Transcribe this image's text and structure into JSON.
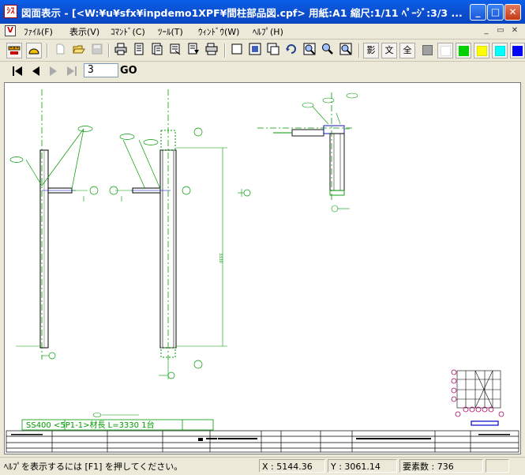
{
  "window": {
    "app_icon": "ｼｽ",
    "title": "図面表示 - [<W:¥u¥sfx¥inpdemo1XPF¥間柱部品図.cpf> 用紙:A1 縮尺:1/11 ﾍﾟｰｼﾞ:3/3 ...",
    "minimize_label": "_",
    "maximize_label": "□",
    "close_label": "✕"
  },
  "menubar": {
    "items": [
      "ﾌｧｲﾙ(F)",
      "表示(V)",
      "ｺﾏﾝﾄﾞ(C)",
      "ﾂｰﾙ(T)",
      "ｳｨﾝﾄﾞｳ(W)",
      "ﾍﾙﾌﾟ(H)"
    ],
    "mdi_minimize": "_",
    "mdi_restore": "▭",
    "mdi_close": "✕"
  },
  "toolbar": {
    "shadow_label": "影",
    "text_label": "文",
    "all_label": "全",
    "colors": [
      "#a0a0a0",
      "#ffffff",
      "#00d000",
      "#ffff00",
      "#00ffff",
      "#0000ff"
    ]
  },
  "navbar": {
    "page_value": "3",
    "go_label": "GO"
  },
  "drawing": {
    "title_block_text": "SS400  <5P1-1>材長 L=3330  1台",
    "dim_height": "3330"
  },
  "statusbar": {
    "help": "ﾍﾙﾌﾟを表示するには [F1] を押してください。",
    "x": "X : 5144.36",
    "y": "Y : 3061.14",
    "count": "要素数 : 736"
  }
}
